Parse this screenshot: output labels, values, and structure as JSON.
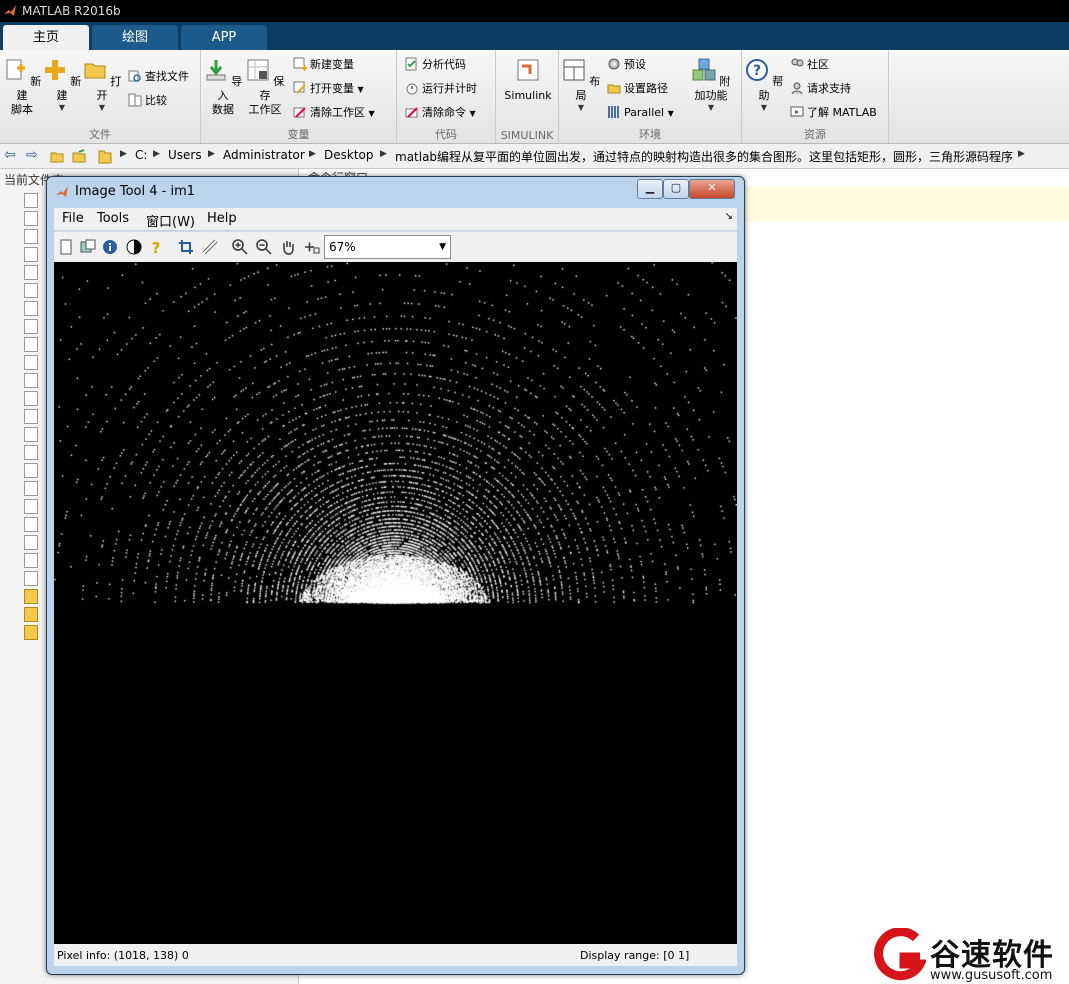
{
  "app": {
    "title": "MATLAB R2016b"
  },
  "tabs": [
    {
      "label": "主页",
      "active": true
    },
    {
      "label": "绘图",
      "active": false
    },
    {
      "label": "APP",
      "active": false
    }
  ],
  "ribbon": {
    "file": {
      "label": "文件",
      "new_script": "新建\n脚本",
      "new": "新建",
      "open": "打开",
      "find_files": "查找文件",
      "compare": "比较"
    },
    "variable": {
      "label": "变量",
      "import": "导入\n数据",
      "save": "保存\n工作区",
      "new_var": "新建变量",
      "open_var": "打开变量",
      "clear_ws": "清除工作区"
    },
    "code": {
      "label": "代码",
      "analyze": "分析代码",
      "run_time": "运行并计时",
      "clear_cmd": "清除命令"
    },
    "simulink": {
      "label": "SIMULINK",
      "simulink": "Simulink"
    },
    "env": {
      "label": "环境",
      "layout": "布局",
      "prefs": "预设",
      "set_path": "设置路径",
      "parallel": "Parallel",
      "addons": "附加功能"
    },
    "resources": {
      "label": "资源",
      "help": "帮助",
      "community": "社区",
      "support": "请求支持",
      "learn": "了解 MATLAB"
    }
  },
  "address": {
    "crumbs": [
      "C:",
      "Users",
      "Administrator",
      "Desktop",
      "matlab编程从复平面的单位圆出发，通过特点的映射构造出很多的集合图形。这里包括矩形，圆形，三角形源码程序"
    ]
  },
  "left_panel": {
    "header": "当前文件夹"
  },
  "command_panel": {
    "header": "命令行窗口"
  },
  "image_tool": {
    "title": "Image Tool 4 - im1",
    "menu": [
      "File",
      "Tools",
      "窗口(W)",
      "Help"
    ],
    "zoom": "67%",
    "pixel_info": "Pixel info: (1018, 138)  0",
    "display_range": "Display range: [0 1]"
  },
  "watermark": {
    "name": "谷速软件",
    "url": "www.gususoft.com"
  },
  "colors": {
    "ribbon_tab_bg": "#0e3d63",
    "watermark_red": "#d7141a"
  }
}
